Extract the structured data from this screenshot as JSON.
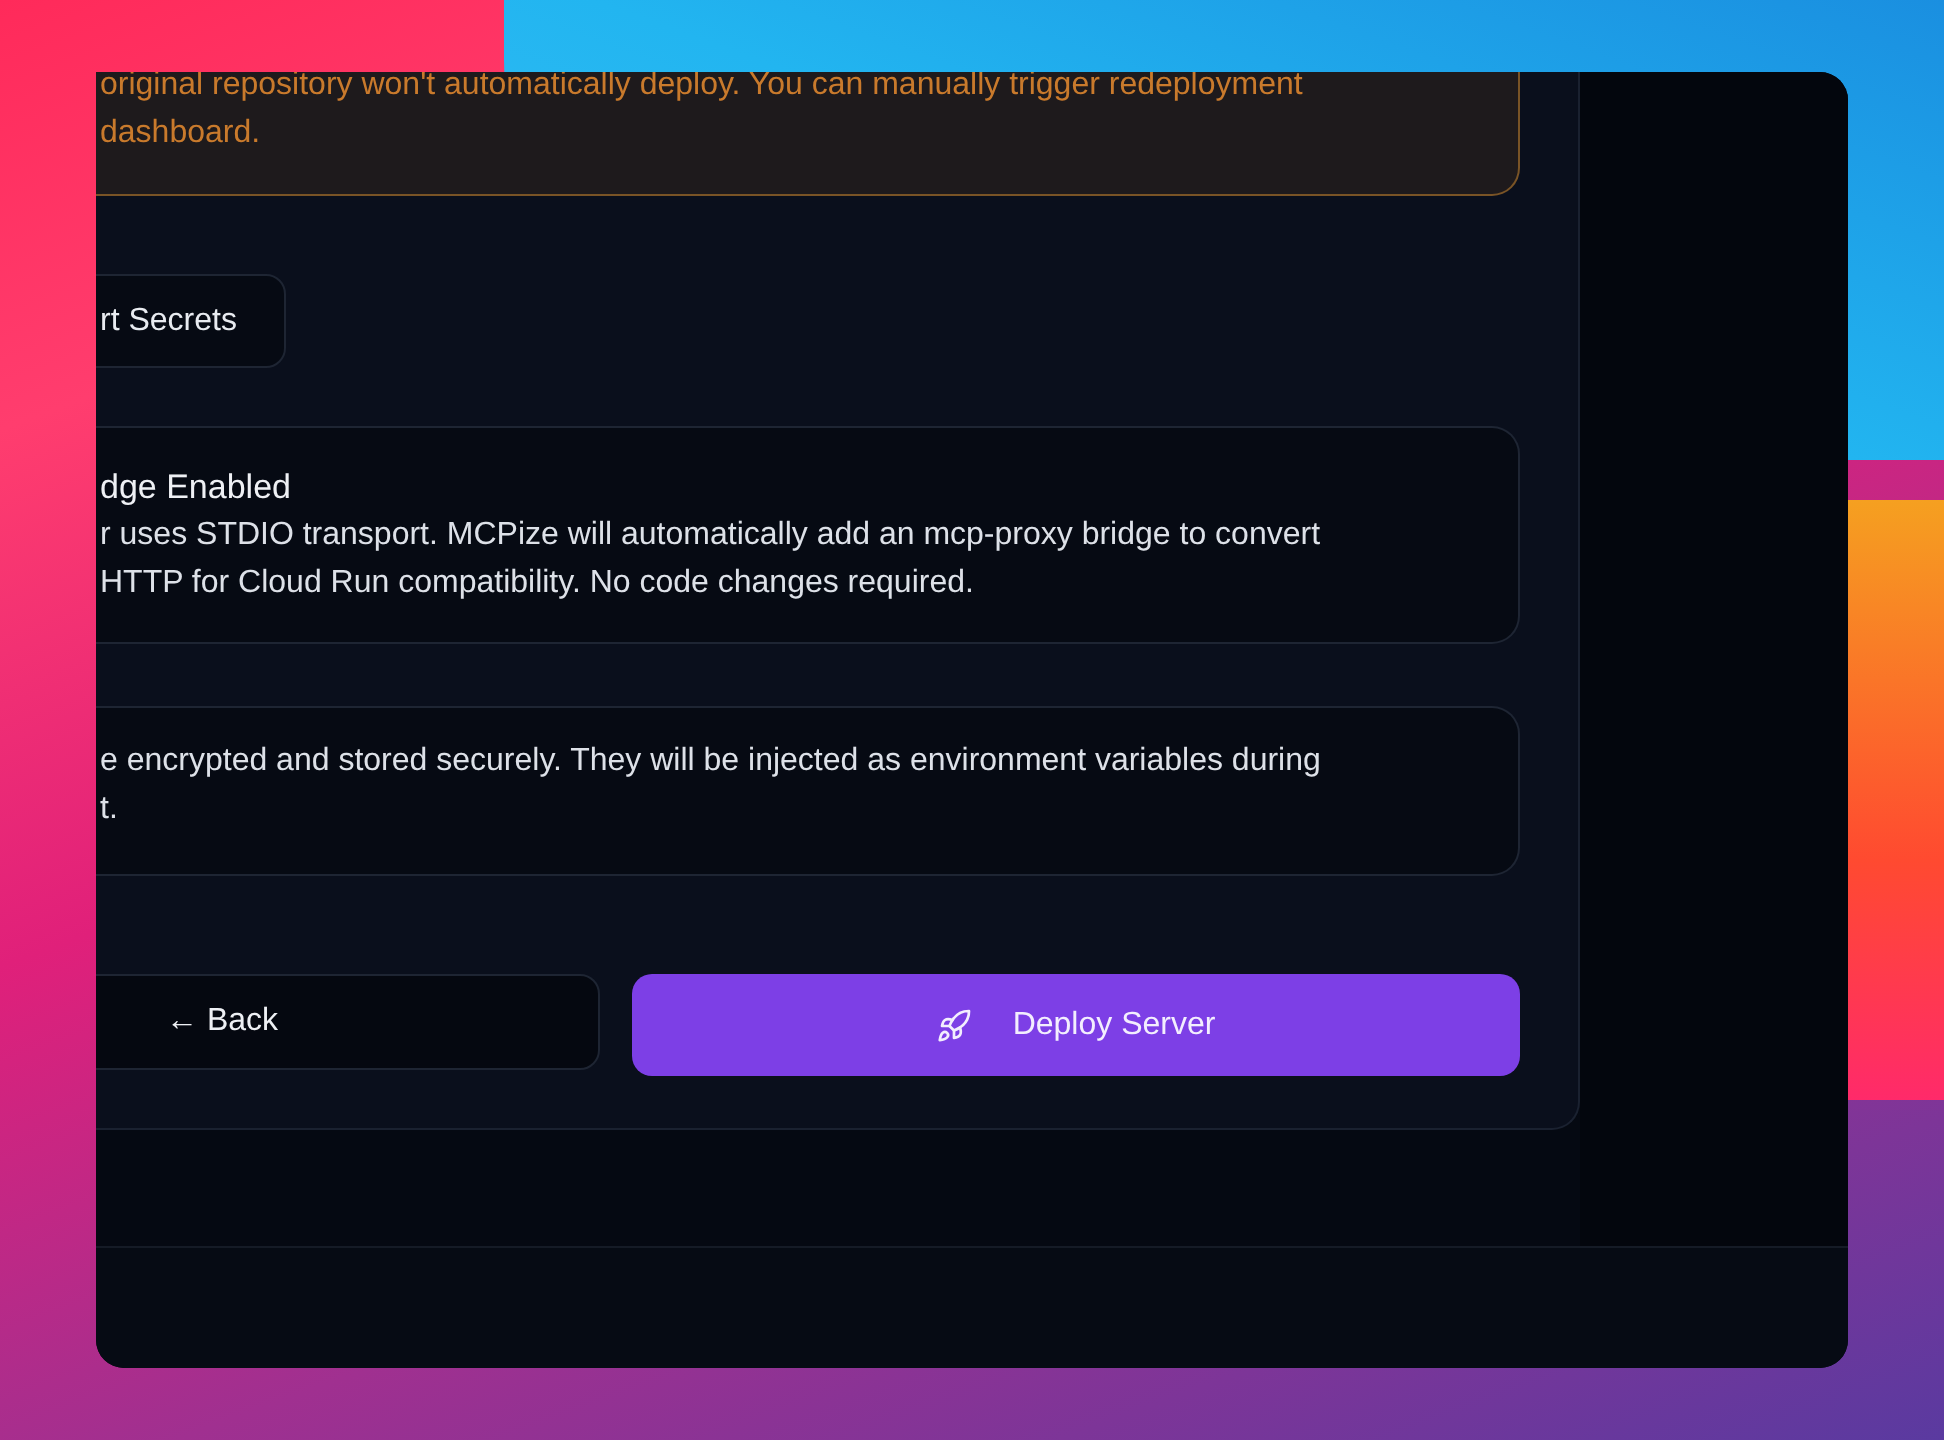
{
  "warning": {
    "lines": [
      "original repository won't automatically deploy. You can manually trigger redeployment",
      "dashboard."
    ]
  },
  "secrets_button": {
    "label": "rt Secrets"
  },
  "bridge_notice": {
    "title": "dge Enabled",
    "lines": [
      "r uses STDIO transport. MCPize will automatically add an mcp-proxy bridge to convert",
      "HTTP for Cloud Run compatibility. No code changes required."
    ]
  },
  "secrets_notice": {
    "lines": [
      "e encrypted and stored securely. They will be injected as environment variables during",
      "t."
    ]
  },
  "back_button": {
    "label": "← Back"
  },
  "deploy_button": {
    "label": "Deploy Server"
  }
}
